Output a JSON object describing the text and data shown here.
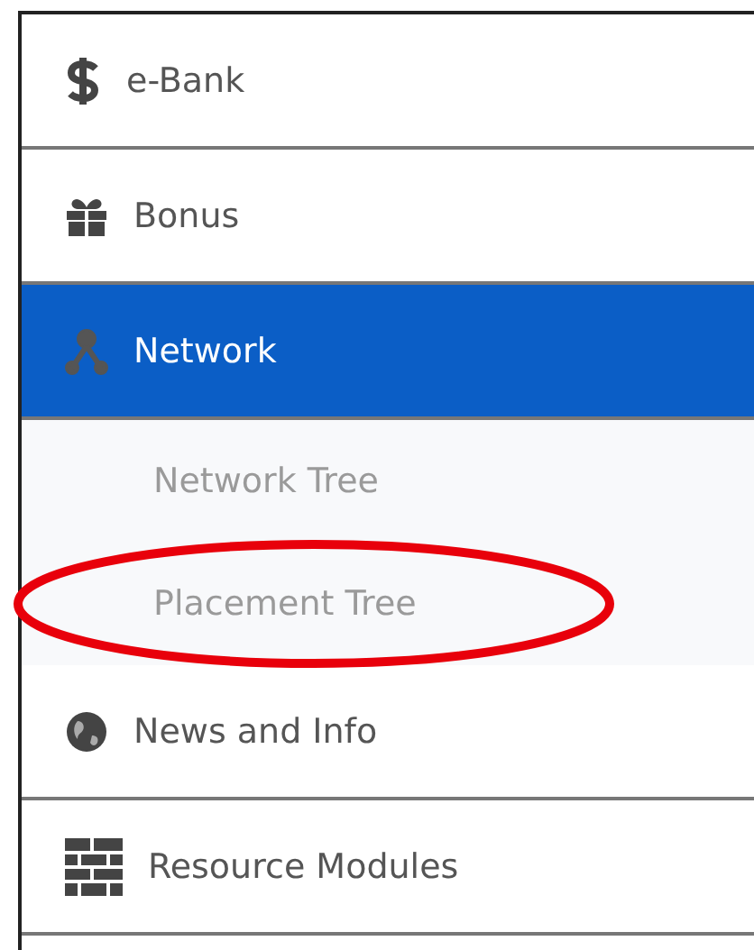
{
  "menu": [
    {
      "label": "e-Bank",
      "selected": false
    },
    {
      "label": "Bonus",
      "selected": false
    },
    {
      "label": "Network",
      "selected": true,
      "expanded": true,
      "children": [
        {
          "label": "Network Tree",
          "circled": false
        },
        {
          "label": "Placement Tree",
          "circled": true
        }
      ]
    },
    {
      "label": "News and Info",
      "selected": false
    },
    {
      "label": "Resource Modules",
      "selected": false
    }
  ]
}
